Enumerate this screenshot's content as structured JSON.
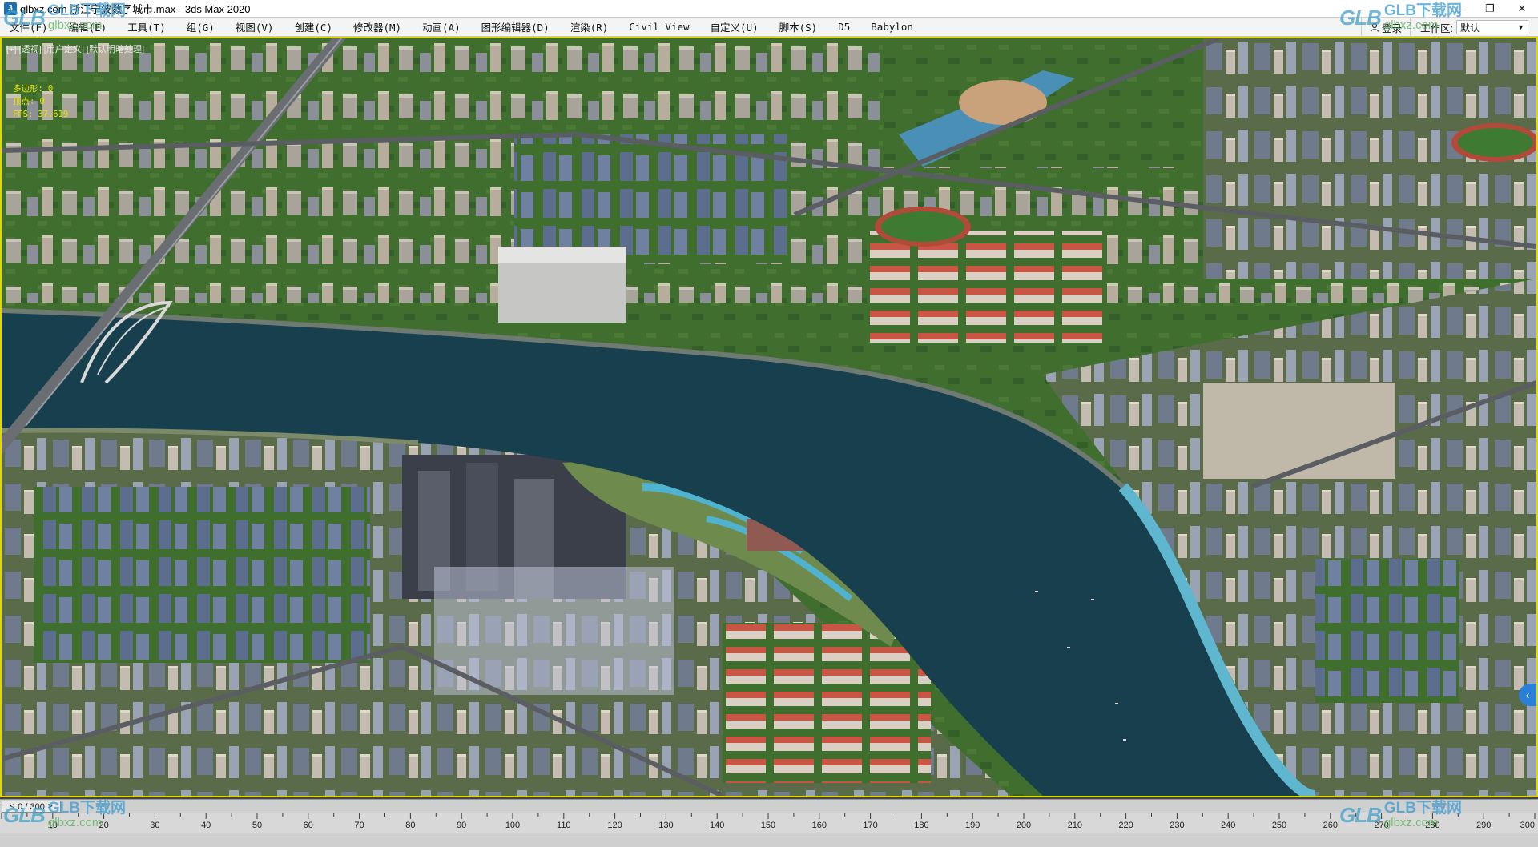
{
  "window": {
    "title": "glbxz.com 浙江宁波数字城市.max - 3ds Max 2020",
    "app_icon_label": "3",
    "controls": {
      "minimize": "—",
      "maximize": "❐",
      "close": "✕"
    }
  },
  "menu": {
    "items": [
      "文件(F)",
      "编辑(E)",
      "工具(T)",
      "组(G)",
      "视图(V)",
      "创建(C)",
      "修改器(M)",
      "动画(A)",
      "图形编辑器(D)",
      "渲染(R)",
      "Civil View",
      "自定义(U)",
      "脚本(S)",
      "D5",
      "Babylon"
    ],
    "login_label": "登录",
    "workspace_label": "工作区:",
    "workspace_value": "默认"
  },
  "viewport": {
    "label": "[+] [透视] [用户定义] [默认明暗处理]",
    "stats": [
      {
        "label": "多边形:",
        "value": "0"
      },
      {
        "label": "顶点:",
        "value": "0"
      },
      {
        "label": "FPS:",
        "value": "37.619"
      }
    ],
    "handle_icon": "chevron-left-icon"
  },
  "timeline": {
    "frame_display": "0 / 300",
    "current_frame": 0,
    "total_frames": 300,
    "tick_labels": [
      "10",
      "20",
      "30",
      "40",
      "50",
      "60",
      "70",
      "80",
      "90",
      "100",
      "110",
      "120",
      "130",
      "140",
      "150",
      "160",
      "170",
      "180",
      "190",
      "200",
      "210",
      "220",
      "230",
      "240",
      "250",
      "260",
      "270",
      "280",
      "290",
      "300"
    ]
  },
  "watermark": {
    "logo": "GLB",
    "name": "GLB下载网",
    "url": "glbxz.com"
  },
  "colors": {
    "viewport_border": "#e2d700",
    "stats_text": "#e6e600",
    "river": "#173f4d",
    "accent_handle": "#2a7fd8"
  }
}
